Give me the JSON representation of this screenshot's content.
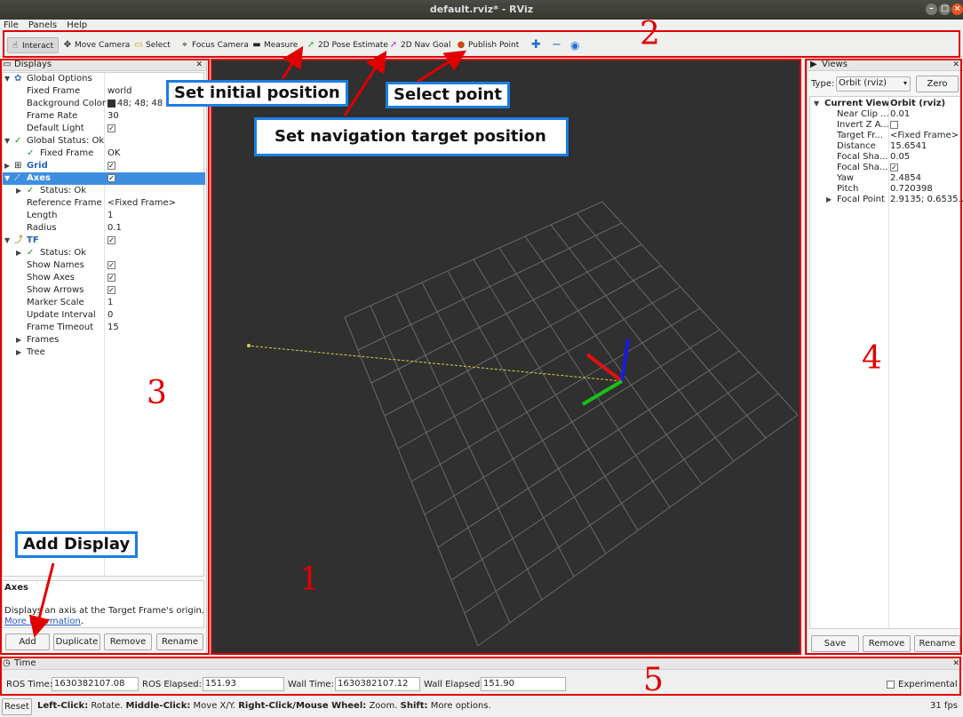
{
  "window": {
    "title": "default.rviz* - RViz"
  },
  "menu": [
    "File",
    "Panels",
    "Help"
  ],
  "toolbar": {
    "interact": "Interact",
    "move_camera": "Move Camera",
    "select": "Select",
    "focus_camera": "Focus Camera",
    "measure": "Measure",
    "pose_estimate": "2D Pose Estimate",
    "nav_goal": "2D Nav Goal",
    "publish_point": "Publish Point"
  },
  "displays": {
    "title": "Displays",
    "rows": [
      {
        "key": "Global Options",
        "value": ""
      },
      {
        "key": "Fixed Frame",
        "value": "world"
      },
      {
        "key": "Background Color",
        "value": "48; 48; 48"
      },
      {
        "key": "Frame Rate",
        "value": "30"
      },
      {
        "key": "Default Light",
        "value": "✓"
      },
      {
        "key": "Global Status: Ok",
        "value": ""
      },
      {
        "key": "Fixed Frame",
        "value": "OK"
      },
      {
        "key": "Grid",
        "value": "✓"
      },
      {
        "key": "Axes",
        "value": "✓"
      },
      {
        "key": "Status: Ok",
        "value": ""
      },
      {
        "key": "Reference Frame",
        "value": "<Fixed Frame>"
      },
      {
        "key": "Length",
        "value": "1"
      },
      {
        "key": "Radius",
        "value": "0.1"
      },
      {
        "key": "TF",
        "value": "✓"
      },
      {
        "key": "Status: Ok",
        "value": ""
      },
      {
        "key": "Show Names",
        "value": "✓"
      },
      {
        "key": "Show Axes",
        "value": "✓"
      },
      {
        "key": "Show Arrows",
        "value": "✓"
      },
      {
        "key": "Marker Scale",
        "value": "1"
      },
      {
        "key": "Update Interval",
        "value": "0"
      },
      {
        "key": "Frame Timeout",
        "value": "15"
      },
      {
        "key": "Frames",
        "value": ""
      },
      {
        "key": "Tree",
        "value": ""
      }
    ],
    "desc_title": "Axes",
    "desc_text_1": "Displays",
    "desc_text_2": "an axis at the Target Frame's origin.",
    "more_info_1": "More In",
    "more_info_2": "formation",
    "more_info_dot": ".",
    "buttons": {
      "add": "Add",
      "duplicate": "Duplicate",
      "remove": "Remove",
      "rename": "Rename"
    }
  },
  "views": {
    "title": "Views",
    "type_label": "Type:",
    "type_value": "Orbit (rviz)",
    "zero": "Zero",
    "header_key": "Current View",
    "header_value": "Orbit (rviz)",
    "rows": [
      {
        "key": "Near Clip ...",
        "value": "0.01"
      },
      {
        "key": "Invert Z A...",
        "value": ""
      },
      {
        "key": "Target Fr...",
        "value": "<Fixed Frame>"
      },
      {
        "key": "Distance",
        "value": "15.6541"
      },
      {
        "key": "Focal Sha...",
        "value": "0.05"
      },
      {
        "key": "Focal Sha...",
        "value": "✓"
      },
      {
        "key": "Yaw",
        "value": "2.4854"
      },
      {
        "key": "Pitch",
        "value": "0.720398"
      },
      {
        "key": "Focal Point",
        "value": "2.9135; 0.6535..."
      }
    ],
    "buttons": {
      "save": "Save",
      "remove": "Remove",
      "rename": "Rename"
    }
  },
  "time": {
    "title": "Time",
    "ros_time_label": "ROS Time:",
    "ros_time": "1630382107.08",
    "ros_elapsed_label": "ROS Elapsed:",
    "ros_elapsed": "151.93",
    "wall_time_label": "Wall Time:",
    "wall_time": "1630382107.12",
    "wall_elapsed_label": "Wall Elapsed:",
    "wall_elapsed": "151.90",
    "experimental": "Experimental"
  },
  "status": {
    "reset": "Reset",
    "h1": "Left-Click:",
    "t1": "Rotate.",
    "h2": "Middle-Click:",
    "t2": "Move X/Y.",
    "h3": "Right-Click/Mouse Wheel:",
    "t3": "Zoom.",
    "h4": "Shift:",
    "t4": "More options.",
    "fps": "31 fps"
  },
  "annotations": {
    "n1": "1",
    "n2": "2",
    "n3": "3",
    "n4": "4",
    "n5": "5",
    "set_initial": "Set initial position",
    "select_point": "Select point",
    "set_nav": "Set navigation target position",
    "add_display": "Add Display"
  },
  "colors": {
    "viewport_bg": "#303030",
    "grid": "#6a6a6a",
    "annotation_red": "#e10000",
    "callout_blue": "#1a7fe0"
  }
}
